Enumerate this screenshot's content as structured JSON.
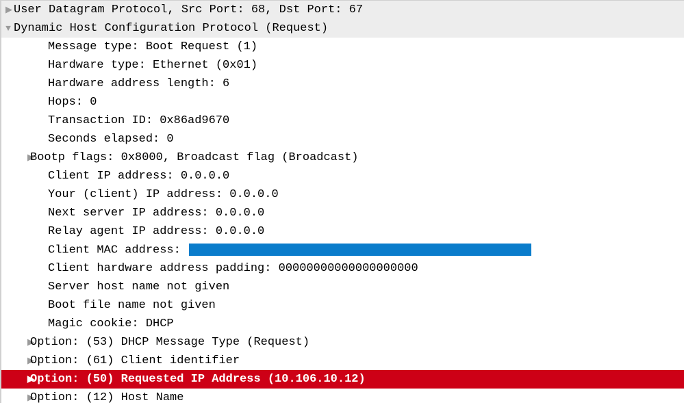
{
  "rows": {
    "udp": "User Datagram Protocol, Src Port: 68, Dst Port: 67",
    "dhcp_title": "Dynamic Host Configuration Protocol (Request)",
    "msg_type": "Message type: Boot Request (1)",
    "hw_type": "Hardware type: Ethernet (0x01)",
    "hw_addr_len": "Hardware address length: 6",
    "hops": "Hops: 0",
    "txn_id": "Transaction ID: 0x86ad9670",
    "secs": "Seconds elapsed: 0",
    "bootp_flags": "Bootp flags: 0x8000, Broadcast flag (Broadcast)",
    "client_ip": "Client IP address: 0.0.0.0",
    "your_ip": "Your (client) IP address: 0.0.0.0",
    "next_server_ip": "Next server IP address: 0.0.0.0",
    "relay_ip": "Relay agent IP address: 0.0.0.0",
    "client_mac_label": "Client MAC address: ",
    "client_hw_padding": "Client hardware address padding: 00000000000000000000",
    "server_host": "Server host name not given",
    "boot_file": "Boot file name not given",
    "magic_cookie": "Magic cookie: DHCP",
    "opt53": "Option: (53) DHCP Message Type (Request)",
    "opt61": "Option: (61) Client identifier",
    "opt50": "Option: (50) Requested IP Address (10.106.10.12)",
    "opt12": "Option: (12) Host Name"
  }
}
